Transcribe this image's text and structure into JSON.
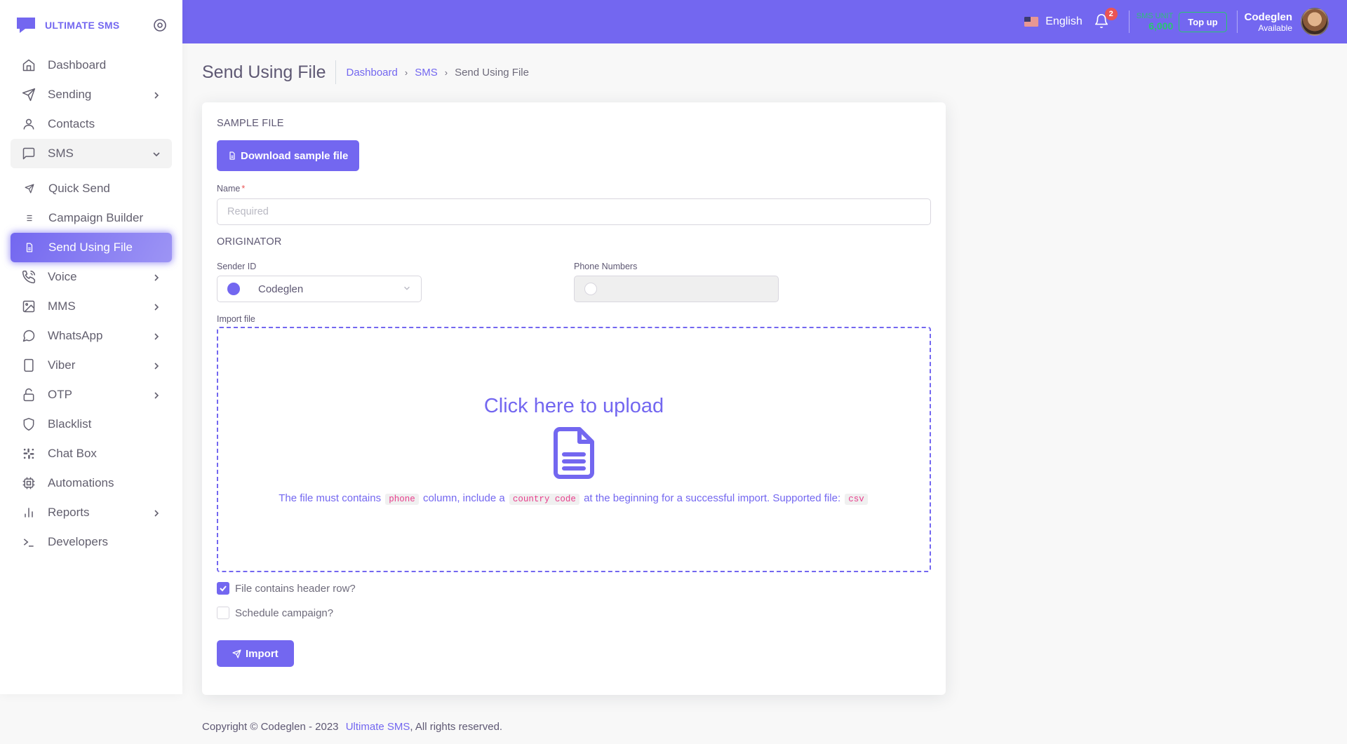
{
  "brand": {
    "name": "ULTIMATE SMS"
  },
  "sidebar": {
    "items": [
      {
        "label": "Dashboard",
        "icon": "home-icon",
        "chevron": false
      },
      {
        "label": "Sending",
        "icon": "send-icon",
        "chevron": true
      },
      {
        "label": "Contacts",
        "icon": "user-icon",
        "chevron": false
      },
      {
        "label": "SMS",
        "icon": "message-square-icon",
        "chevron": "down",
        "open": true
      },
      {
        "label": "Quick Send",
        "icon": "send-small-icon",
        "sub": true
      },
      {
        "label": "Campaign Builder",
        "icon": "list-icon",
        "sub": true
      },
      {
        "label": "Send Using File",
        "icon": "file-icon",
        "sub": true,
        "active": true
      },
      {
        "label": "Voice",
        "icon": "phone-call-icon",
        "chevron": true
      },
      {
        "label": "MMS",
        "icon": "image-icon",
        "chevron": true
      },
      {
        "label": "WhatsApp",
        "icon": "message-circle-icon",
        "chevron": true
      },
      {
        "label": "Viber",
        "icon": "tablet-icon",
        "chevron": true
      },
      {
        "label": "OTP",
        "icon": "unlock-icon",
        "chevron": true
      },
      {
        "label": "Blacklist",
        "icon": "shield-icon",
        "chevron": false
      },
      {
        "label": "Chat Box",
        "icon": "slack-icon",
        "chevron": false
      },
      {
        "label": "Automations",
        "icon": "cpu-icon",
        "chevron": false
      },
      {
        "label": "Reports",
        "icon": "bar-chart-icon",
        "chevron": true
      },
      {
        "label": "Developers",
        "icon": "terminal-icon",
        "chevron": false
      }
    ]
  },
  "topbar": {
    "language": "English",
    "notifications_count": "2",
    "sms_unit_label": "SMS UNIT",
    "sms_unit_value": "6,000",
    "topup_label": "Top up",
    "user_name": "Codeglen",
    "user_status": "Available"
  },
  "page": {
    "title": "Send Using File",
    "breadcrumb": [
      "Dashboard",
      "SMS",
      "Send Using File"
    ]
  },
  "form": {
    "sample_file_title": "SAMPLE FILE",
    "download_button": "Download sample file",
    "name_label": "Name",
    "name_placeholder": "Required",
    "originator_title": "ORIGINATOR",
    "sender_id_label": "Sender ID",
    "sender_id_value": "Codeglen",
    "phone_numbers_label": "Phone Numbers",
    "import_file_label": "Import file",
    "upload_title": "Click here to upload",
    "help_part1": "The file must contains",
    "help_code1": "phone",
    "help_part2": "column, include a",
    "help_code2": "country code",
    "help_part3": "at the beginning for a successful import. Supported file:",
    "help_code3": "csv",
    "header_row_label": "File contains header row?",
    "header_row_checked": true,
    "schedule_label": "Schedule campaign?",
    "schedule_checked": false,
    "import_button": "Import"
  },
  "footer": {
    "text": "Copyright © Codeglen - 2023",
    "link": "Ultimate SMS",
    "suffix": ", All rights reserved."
  },
  "colors": {
    "primary": "#7367f0",
    "success": "#28c76f",
    "danger": "#ea5455"
  }
}
